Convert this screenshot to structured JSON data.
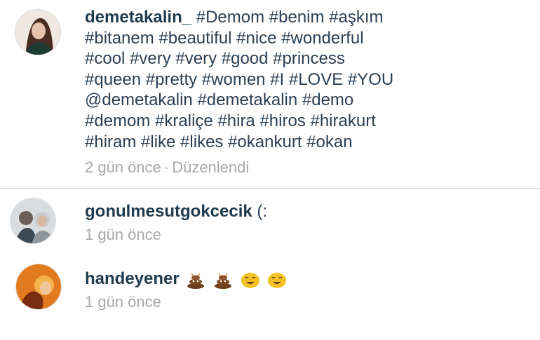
{
  "post": {
    "username": "demetakalin_",
    "caption_lines": [
      "#Demom #benim #aşkım",
      "#bitanem #beautiful #nice #wonderful",
      "#cool #very #very #good #princess",
      "#queen #pretty #women #I #LOVE #YOU",
      "@demetakalin #demetakalin #demo",
      "#demom #kraliçe #hira #hiros #hirakurt",
      "#hiram #like #likes #okankurt #okan"
    ],
    "time": "2 gün önce",
    "separator": "·",
    "edited": "Düzenlendi"
  },
  "comments": [
    {
      "username": "gonulmesutgokcecik",
      "text": "(:",
      "time": "1 gün önce"
    },
    {
      "username": "handeyener",
      "text": "",
      "emojis": [
        "poop-emoji",
        "poop-emoji",
        "smiling-face-emoji",
        "smiling-face-emoji"
      ],
      "time": "1 gün önce"
    }
  ],
  "colors": {
    "username": "#1f3a4d",
    "meta_text": "#a8a8a8",
    "divider": "#e2e2e2"
  }
}
